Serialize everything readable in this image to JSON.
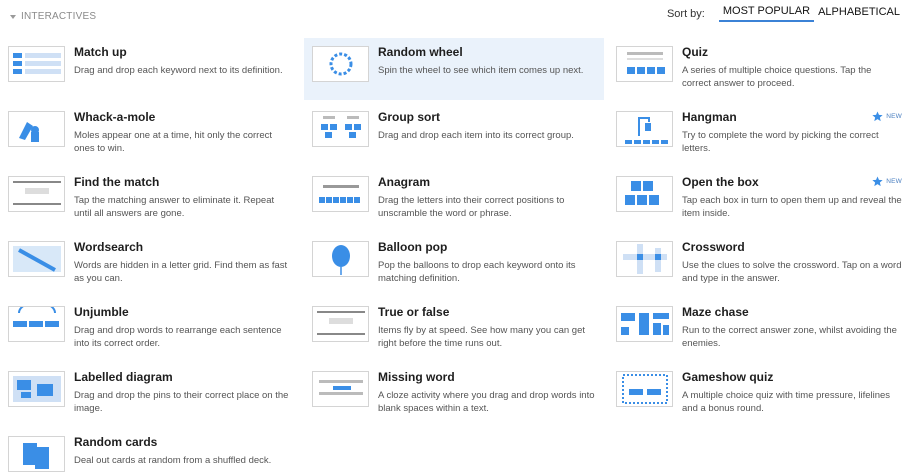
{
  "section": {
    "title": "INTERACTIVES"
  },
  "sort": {
    "label": "Sort by:",
    "options": [
      "MOST POPULAR",
      "ALPHABETICAL"
    ],
    "selected": "MOST POPULAR"
  },
  "colors": {
    "accent": "#3b82d6",
    "highlight": "#eaf2fb",
    "icon_blue": "#3a8ee6"
  },
  "templates": [
    {
      "title": "Match up",
      "desc": "Drag and drop each keyword next to its definition.",
      "icon": "match-up-thumbnail-icon",
      "badge": ""
    },
    {
      "title": "Random wheel",
      "desc": "Spin the wheel to see which item comes up next.",
      "icon": "random-wheel-thumbnail-icon",
      "badge": ""
    },
    {
      "title": "Quiz",
      "desc": "A series of multiple choice questions. Tap the correct answer to proceed.",
      "icon": "quiz-thumbnail-icon",
      "badge": ""
    },
    {
      "title": "Whack-a-mole",
      "desc": "Moles appear one at a time, hit only the correct ones to win.",
      "icon": "whack-a-mole-thumbnail-icon",
      "badge": ""
    },
    {
      "title": "Group sort",
      "desc": "Drag and drop each item into its correct group.",
      "icon": "group-sort-thumbnail-icon",
      "badge": ""
    },
    {
      "title": "Hangman",
      "desc": "Try to complete the word by picking the correct letters.",
      "icon": "hangman-thumbnail-icon",
      "badge": "NEW"
    },
    {
      "title": "Find the match",
      "desc": "Tap the matching answer to eliminate it. Repeat until all answers are gone.",
      "icon": "find-the-match-thumbnail-icon",
      "badge": ""
    },
    {
      "title": "Anagram",
      "desc": "Drag the letters into their correct positions to unscramble the word or phrase.",
      "icon": "anagram-thumbnail-icon",
      "badge": ""
    },
    {
      "title": "Open the box",
      "desc": "Tap each box in turn to open them up and reveal the item inside.",
      "icon": "open-the-box-thumbnail-icon",
      "badge": "NEW"
    },
    {
      "title": "Wordsearch",
      "desc": "Words are hidden in a letter grid. Find them as fast as you can.",
      "icon": "wordsearch-thumbnail-icon",
      "badge": ""
    },
    {
      "title": "Balloon pop",
      "desc": "Pop the balloons to drop each keyword onto its matching definition.",
      "icon": "balloon-pop-thumbnail-icon",
      "badge": ""
    },
    {
      "title": "Crossword",
      "desc": "Use the clues to solve the crossword. Tap on a word and type in the answer.",
      "icon": "crossword-thumbnail-icon",
      "badge": ""
    },
    {
      "title": "Unjumble",
      "desc": "Drag and drop words to rearrange each sentence into its correct order.",
      "icon": "unjumble-thumbnail-icon",
      "badge": ""
    },
    {
      "title": "True or false",
      "desc": "Items fly by at speed. See how many you can get right before the time runs out.",
      "icon": "true-or-false-thumbnail-icon",
      "badge": ""
    },
    {
      "title": "Maze chase",
      "desc": "Run to the correct answer zone, whilst avoiding the enemies.",
      "icon": "maze-chase-thumbnail-icon",
      "badge": ""
    },
    {
      "title": "Labelled diagram",
      "desc": "Drag and drop the pins to their correct place on the image.",
      "icon": "labelled-diagram-thumbnail-icon",
      "badge": ""
    },
    {
      "title": "Missing word",
      "desc": "A cloze activity where you drag and drop words into blank spaces within a text.",
      "icon": "missing-word-thumbnail-icon",
      "badge": ""
    },
    {
      "title": "Gameshow quiz",
      "desc": "A multiple choice quiz with time pressure, lifelines and a bonus round.",
      "icon": "gameshow-quiz-thumbnail-icon",
      "badge": ""
    },
    {
      "title": "Random cards",
      "desc": "Deal out cards at random from a shuffled deck.",
      "icon": "random-cards-thumbnail-icon",
      "badge": ""
    }
  ]
}
